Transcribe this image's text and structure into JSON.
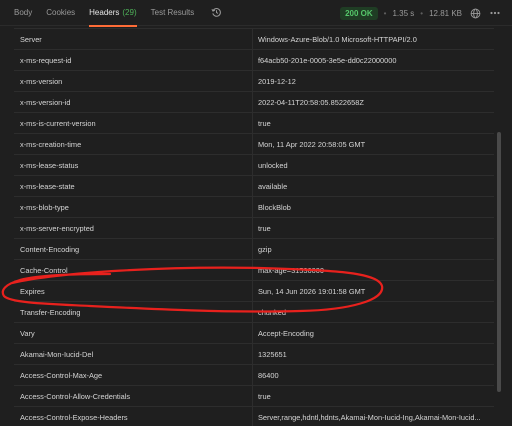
{
  "tabs": {
    "body": "Body",
    "cookies": "Cookies",
    "headers": "Headers",
    "headers_count": "(29)",
    "test_results": "Test Results"
  },
  "status": {
    "code": "200 OK",
    "time": "1.35 s",
    "size": "12.81 KB"
  },
  "icons": {
    "history": "history-icon",
    "globe": "globe-icon",
    "more": "more-icon"
  },
  "colors": {
    "accent": "#ff6c37",
    "status_ok": "#55c76a",
    "annotation": "#e8211d"
  },
  "headers": [
    {
      "key": "Server",
      "value": "Windows-Azure-Blob/1.0 Microsoft-HTTPAPI/2.0"
    },
    {
      "key": "x-ms-request-id",
      "value": "f64acb50-201e-0005-3e5e-dd0c22000000"
    },
    {
      "key": "x-ms-version",
      "value": "2019-12-12"
    },
    {
      "key": "x-ms-version-id",
      "value": "2022-04-11T20:58:05.8522658Z"
    },
    {
      "key": "x-ms-is-current-version",
      "value": "true"
    },
    {
      "key": "x-ms-creation-time",
      "value": "Mon, 11 Apr 2022 20:58:05 GMT"
    },
    {
      "key": "x-ms-lease-status",
      "value": "unlocked"
    },
    {
      "key": "x-ms-lease-state",
      "value": "available"
    },
    {
      "key": "x-ms-blob-type",
      "value": "BlockBlob"
    },
    {
      "key": "x-ms-server-encrypted",
      "value": "true"
    },
    {
      "key": "Content-Encoding",
      "value": "gzip"
    },
    {
      "key": "Cache-Control",
      "value": "max-age=31536000"
    },
    {
      "key": "Expires",
      "value": "Sun, 14 Jun 2026 19:01:58 GMT"
    },
    {
      "key": "Transfer-Encoding",
      "value": "chunked"
    },
    {
      "key": "Vary",
      "value": "Accept-Encoding"
    },
    {
      "key": "Akamai-Mon-Iucid-Del",
      "value": "1325651"
    },
    {
      "key": "Access-Control-Max-Age",
      "value": "86400"
    },
    {
      "key": "Access-Control-Allow-Credentials",
      "value": "true"
    },
    {
      "key": "Access-Control-Expose-Headers",
      "value": "Server,range,hdntl,hdnts,Akamai-Mon-Iucid-Ing,Akamai-Mon-Iucid..."
    }
  ]
}
